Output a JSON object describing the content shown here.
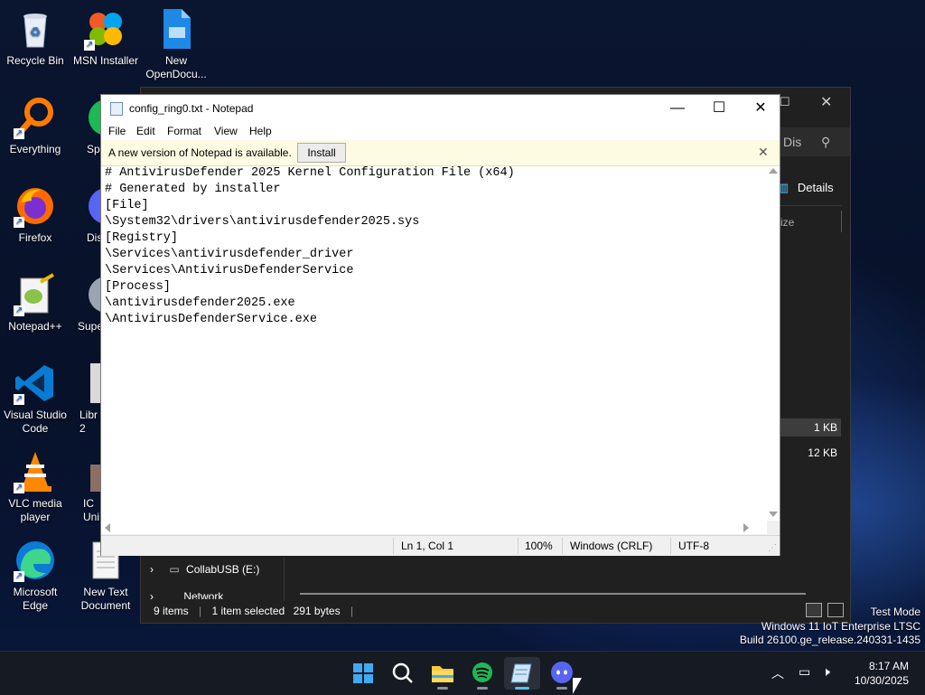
{
  "desktop": {
    "icons": [
      {
        "label": "Recycle Bin",
        "icon": "recycle-bin-icon"
      },
      {
        "label": "MSN Installer",
        "icon": "msn-butterfly-icon"
      },
      {
        "label": "New OpenDocu...",
        "icon": "document-icon"
      },
      {
        "label": "Everything",
        "icon": "magnifier-icon"
      },
      {
        "label": "Sp",
        "icon": "spotify-icon"
      },
      {
        "label": "Firefox",
        "icon": "firefox-icon"
      },
      {
        "label": "Dis",
        "icon": "discord-icon"
      },
      {
        "label": "Notepad++",
        "icon": "notepadpp-icon"
      },
      {
        "label": "Supe",
        "icon": "app-icon"
      },
      {
        "label": "Visual Studio Code",
        "icon": "vscode-icon"
      },
      {
        "label": "Libr 2",
        "icon": "libreoffice-icon"
      },
      {
        "label": "VLC media player",
        "icon": "vlc-icon"
      },
      {
        "label": "IC Uni",
        "icon": "app-icon"
      },
      {
        "label": "Microsoft Edge",
        "icon": "edge-icon"
      },
      {
        "label": "New Text Document",
        "icon": "text-document-icon"
      }
    ]
  },
  "explorer": {
    "search_text": "Dis",
    "details_label": "Details",
    "size_header": "ize",
    "row1_size": "1 KB",
    "row2_size": "12 KB",
    "nav_item": "CollabUSB (E:)",
    "nav_item2": "Network",
    "status_items": "9 items",
    "status_selected": "1 item selected",
    "status_bytes": "291 bytes"
  },
  "notepad": {
    "title": "config_ring0.txt - Notepad",
    "menu": [
      "File",
      "Edit",
      "Format",
      "View",
      "Help"
    ],
    "info_message": "A new version of Notepad is available.",
    "install_label": "Install",
    "lines": [
      "# AntivirusDefender 2025 Kernel Configuration File (x64)",
      "# Generated by installer",
      "[File]",
      "\\System32\\drivers\\antivirusdefender2025.sys",
      "[Registry]",
      "\\Services\\antivirusdefender_driver",
      "\\Services\\AntivirusDefenderService",
      "[Process]",
      "\\antivirusdefender2025.exe",
      "\\AntivirusDefenderService.exe"
    ],
    "status": {
      "position": "Ln 1, Col 1",
      "zoom": "100%",
      "line_ending": "Windows (CRLF)",
      "encoding": "UTF-8"
    }
  },
  "watermark": {
    "line1": "Test Mode",
    "line2": "Windows 11 IoT Enterprise LTSC",
    "line3": "Build 26100.ge_release.240331-1435"
  },
  "clock": {
    "time": "8:17 AM",
    "date": "10/30/2025"
  },
  "colors": {
    "taskbar_accent": "#4cc2ff",
    "info_bar": "#fdfbe2"
  }
}
